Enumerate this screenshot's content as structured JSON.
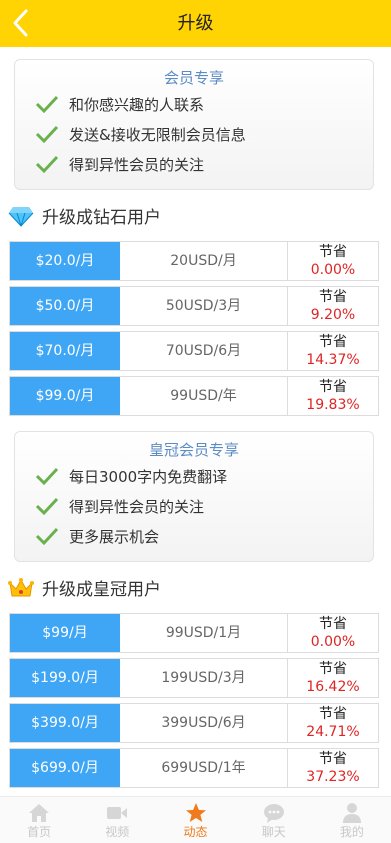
{
  "header": {
    "title": "升级"
  },
  "member_perks": {
    "title": "会员专享",
    "items": [
      "和你感兴趣的人联系",
      "发送&接收无限制会员信息",
      "得到异性会员的关注"
    ]
  },
  "diamond": {
    "heading": "升级成钻石用户",
    "plans": [
      {
        "price": "$20.0/月",
        "duration": "20USD/月",
        "save_label": "节省",
        "save_pct": "0.00%"
      },
      {
        "price": "$50.0/月",
        "duration": "50USD/3月",
        "save_label": "节省",
        "save_pct": "9.20%"
      },
      {
        "price": "$70.0/月",
        "duration": "70USD/6月",
        "save_label": "节省",
        "save_pct": "14.37%"
      },
      {
        "price": "$99.0/月",
        "duration": "99USD/年",
        "save_label": "节省",
        "save_pct": "19.83%"
      }
    ]
  },
  "crown_perks": {
    "title": "皇冠会员专享",
    "items": [
      "每日3000字内免费翻译",
      "得到异性会员的关注",
      "更多展示机会"
    ]
  },
  "crown": {
    "heading": "升级成皇冠用户",
    "plans": [
      {
        "price": "$99/月",
        "duration": "99USD/1月",
        "save_label": "节省",
        "save_pct": "0.00%"
      },
      {
        "price": "$199.0/月",
        "duration": "199USD/3月",
        "save_label": "节省",
        "save_pct": "16.42%"
      },
      {
        "price": "$399.0/月",
        "duration": "399USD/6月",
        "save_label": "节省",
        "save_pct": "24.71%"
      },
      {
        "price": "$699.0/月",
        "duration": "699USD/1年",
        "save_label": "节省",
        "save_pct": "37.23%"
      }
    ]
  },
  "tabbar": {
    "items": [
      {
        "label": "首页",
        "icon": "home-icon",
        "active": false
      },
      {
        "label": "视频",
        "icon": "video-icon",
        "active": false
      },
      {
        "label": "动态",
        "icon": "star-icon",
        "active": true
      },
      {
        "label": "聊天",
        "icon": "chat-icon",
        "active": false
      },
      {
        "label": "我的",
        "icon": "user-icon",
        "active": false
      }
    ]
  },
  "colors": {
    "header_bg": "#ffd402",
    "price_bg": "#3fa6f6",
    "save_red": "#e02424",
    "check_green": "#6ab04c",
    "active_tab": "#f07b1c"
  }
}
